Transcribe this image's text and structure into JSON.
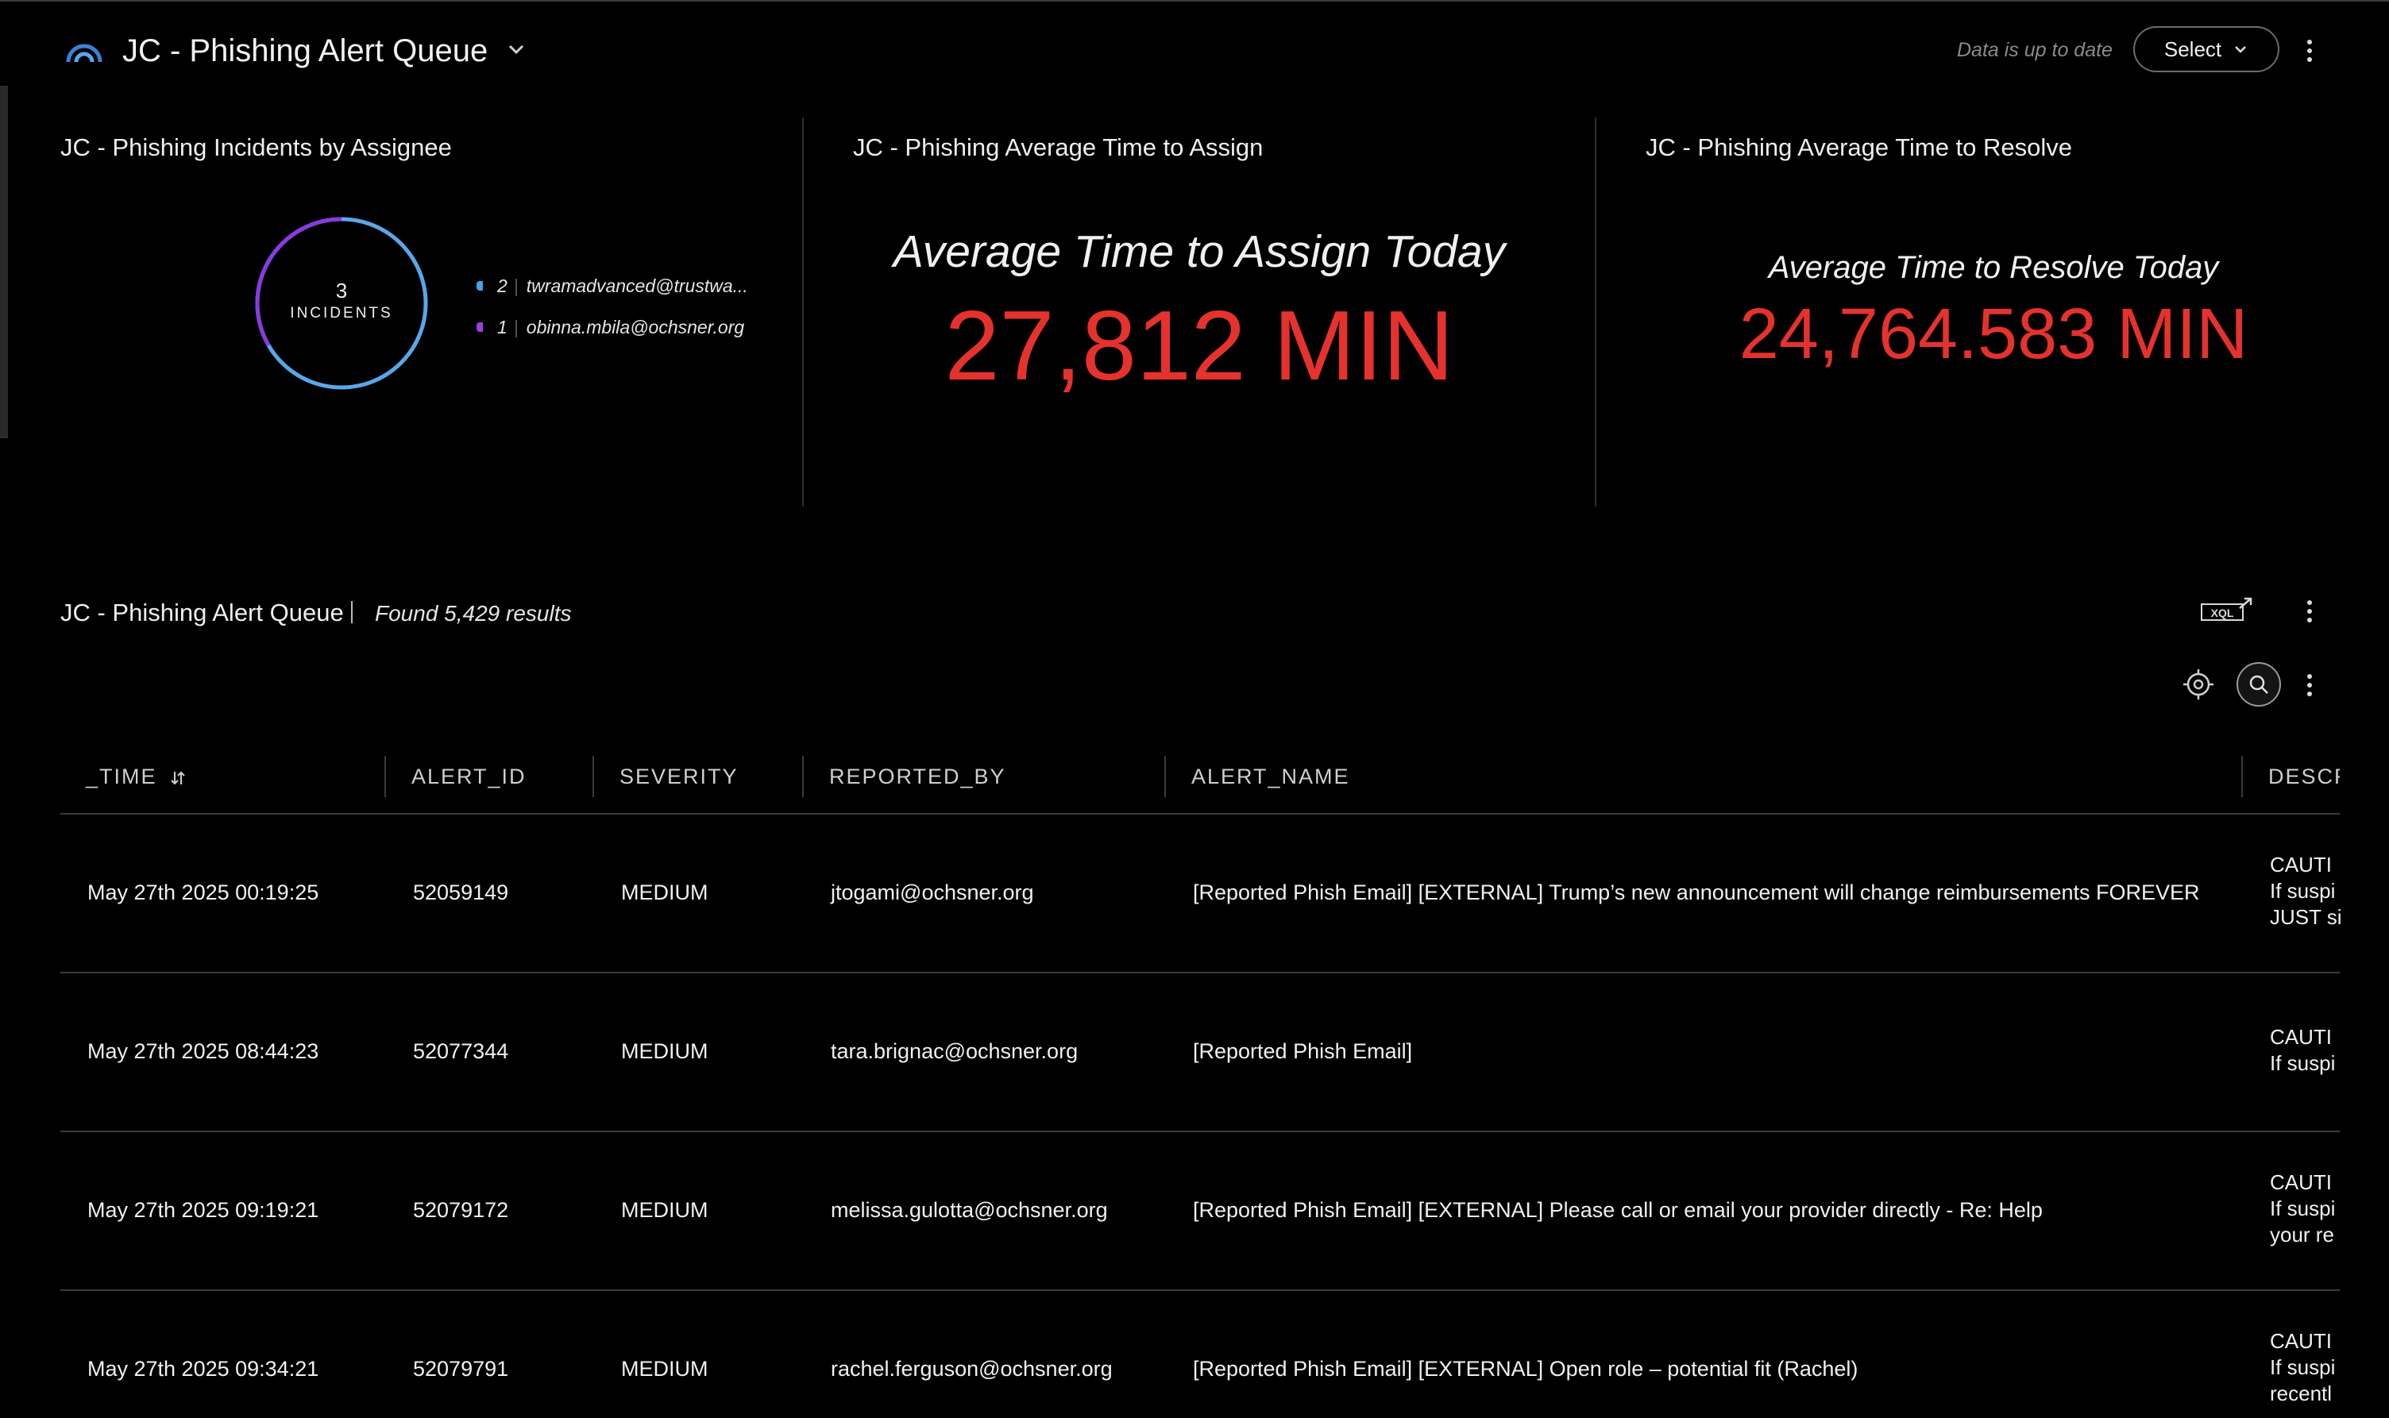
{
  "dashboard": {
    "title": "JC - Phishing Alert Queue",
    "status": "Data is up to date",
    "select_label": "Select"
  },
  "widgets": {
    "assignee": {
      "title": "JC - Phishing Incidents by Assignee",
      "total": "3",
      "total_label": "INCIDENTS",
      "legend": [
        {
          "count": "2",
          "name": "twramadvanced@trustwa...",
          "color": "#4a9fe8"
        },
        {
          "count": "1",
          "name": "obinna.mbila@ochsner.org",
          "color": "#9b3fe0"
        }
      ],
      "arc_colors": {
        "primary": "#5aa6ea",
        "secondary": "#8a3ae0"
      }
    },
    "assign": {
      "title": "JC - Phishing Average Time to Assign",
      "kpi_label": "Average Time to Assign Today",
      "kpi_value": "27,812 MIN",
      "value_color": "#e5322d"
    },
    "resolve": {
      "title": "JC - Phishing Average Time to Resolve",
      "kpi_label": "Average Time to Resolve Today",
      "kpi_value": "24,764.583 MIN",
      "value_color": "#e5322d"
    }
  },
  "table": {
    "title": "JC - Phishing Alert Queue",
    "found": "Found 5,429 results",
    "xql_label": "XQL",
    "columns": [
      "_TIME",
      "ALERT_ID",
      "SEVERITY",
      "REPORTED_BY",
      "ALERT_NAME",
      "DESCR"
    ],
    "rows": [
      {
        "time": "May 27th 2025 00:19:25",
        "alert_id": "52059149",
        "severity": "MEDIUM",
        "reported_by": "jtogami@ochsner.org",
        "alert_name": "[Reported Phish Email] [EXTERNAL] Trump’s new announcement will change reimbursements FOREVER",
        "description": [
          "CAUTI",
          "If suspi",
          "JUST si"
        ]
      },
      {
        "time": "May 27th 2025 08:44:23",
        "alert_id": "52077344",
        "severity": "MEDIUM",
        "reported_by": "tara.brignac@ochsner.org",
        "alert_name": "[Reported Phish Email]",
        "description": [
          "CAUTI",
          "If suspi"
        ]
      },
      {
        "time": "May 27th 2025 09:19:21",
        "alert_id": "52079172",
        "severity": "MEDIUM",
        "reported_by": "melissa.gulotta@ochsner.org",
        "alert_name": "[Reported Phish Email] [EXTERNAL] Please call or email your provider directly - Re: Help",
        "description": [
          "CAUTI",
          "If suspi",
          "your re"
        ]
      },
      {
        "time": "May 27th 2025 09:34:21",
        "alert_id": "52079791",
        "severity": "MEDIUM",
        "reported_by": "rachel.ferguson@ochsner.org",
        "alert_name": "[Reported Phish Email] [EXTERNAL] Open role – potential fit (Rachel)",
        "description": [
          "CAUTI",
          "If suspi",
          "recentl"
        ]
      }
    ]
  }
}
